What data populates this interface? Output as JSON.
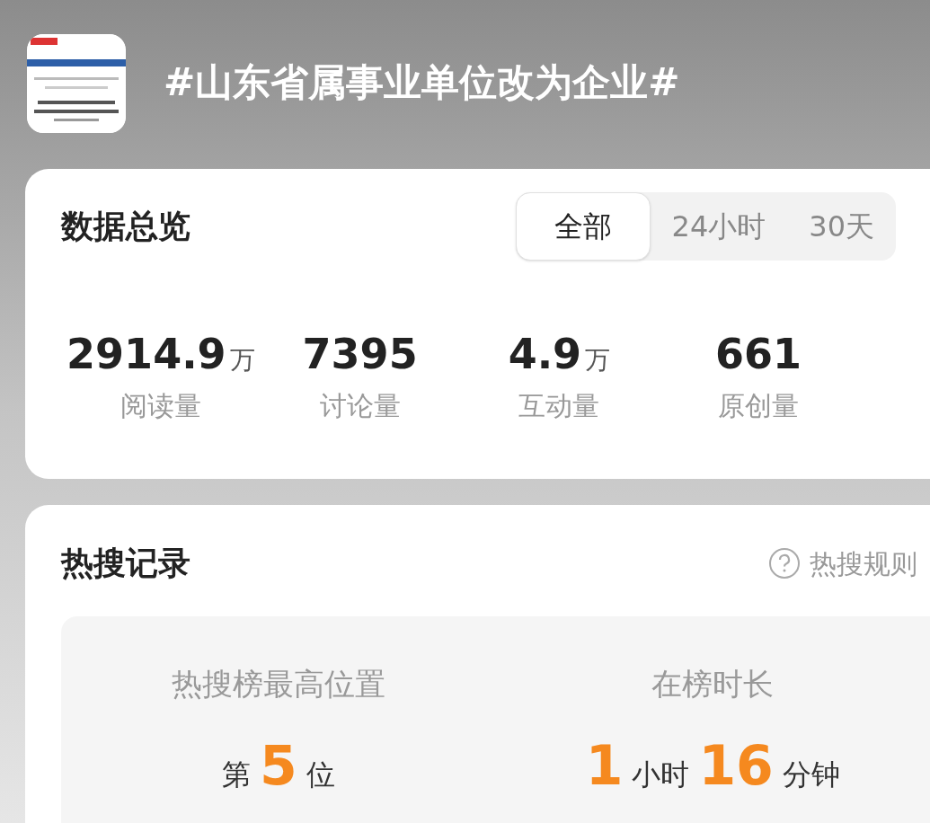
{
  "header": {
    "title": "#山东省属事业单位改为企业#"
  },
  "overview": {
    "title": "数据总览",
    "tabs": [
      {
        "label": "全部",
        "selected": true
      },
      {
        "label": "24小时",
        "selected": false
      },
      {
        "label": "30天",
        "selected": false
      }
    ],
    "stats": [
      {
        "value": "2914.9",
        "unit": "万",
        "label": "阅读量"
      },
      {
        "value": "7395",
        "label": "讨论量"
      },
      {
        "value": "4.9",
        "unit": "万",
        "label": "互动量"
      },
      {
        "value": "661",
        "label": "原创量"
      }
    ]
  },
  "hot_search": {
    "title": "热搜记录",
    "rules_link": "热搜规则",
    "metrics": [
      {
        "label": "热搜榜最高位置",
        "parts": [
          {
            "kind": "text",
            "text": "第"
          },
          {
            "kind": "number",
            "text": "5"
          },
          {
            "kind": "text",
            "text": "位"
          }
        ]
      },
      {
        "label": "在榜时长",
        "parts": [
          {
            "kind": "number",
            "text": "1"
          },
          {
            "kind": "text",
            "text": "小时"
          },
          {
            "kind": "number",
            "text": "16"
          },
          {
            "kind": "text",
            "text": "分钟"
          }
        ]
      }
    ]
  }
}
